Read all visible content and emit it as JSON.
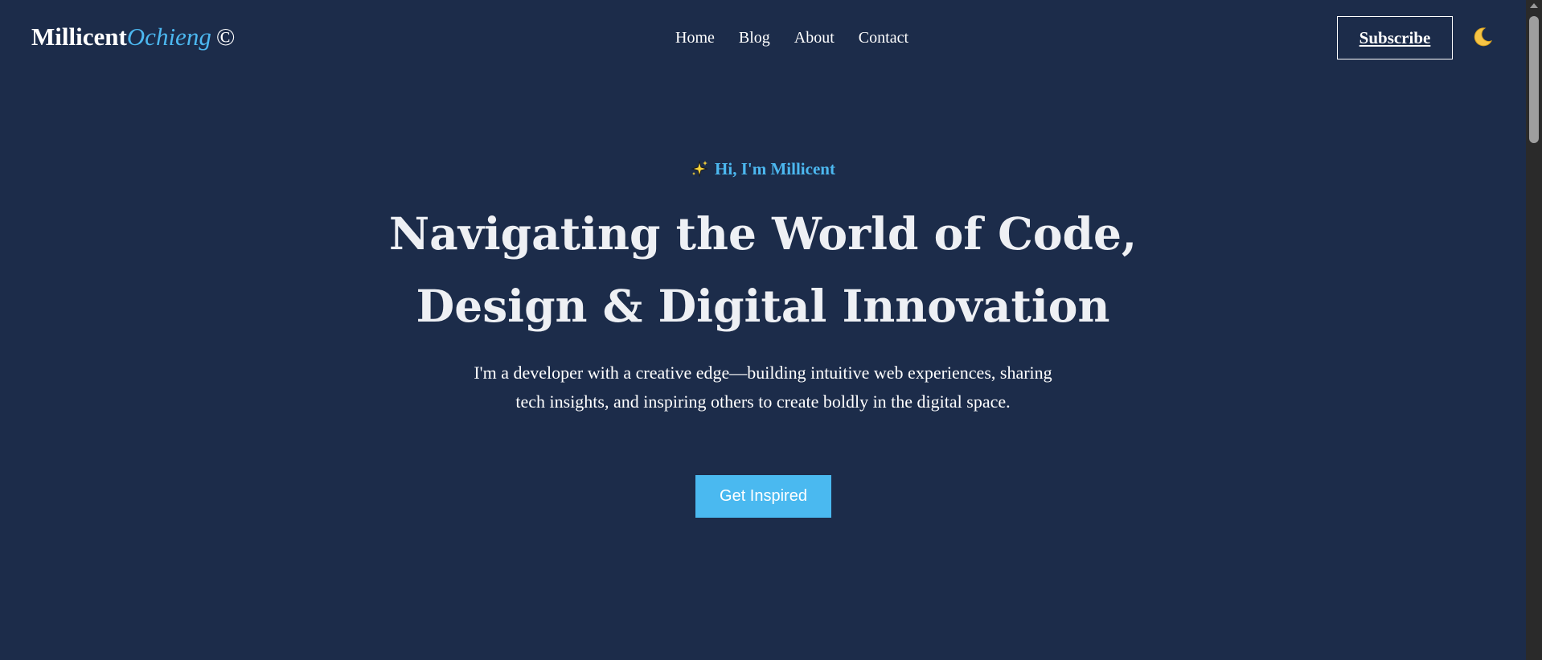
{
  "header": {
    "logo": {
      "first": "Millicent",
      "last": "Ochieng",
      "mark": "©"
    },
    "nav": [
      {
        "label": "Home"
      },
      {
        "label": "Blog"
      },
      {
        "label": "About"
      },
      {
        "label": "Contact"
      }
    ],
    "subscribe_label": "Subscribe",
    "theme_toggle_icon": "moon-icon"
  },
  "hero": {
    "eyebrow_icon": "sparkles-icon",
    "eyebrow": "Hi, I'm Millicent",
    "headline_line1": "Navigating the World of Code,",
    "headline_line2": "Design & Digital Innovation",
    "subtext": "I'm a developer with a creative edge—building intuitive web experiences, sharing tech insights, and inspiring others to create boldly in the digital space.",
    "cta_label": "Get Inspired"
  },
  "colors": {
    "background": "#1c2c4a",
    "accent": "#4cb8f0",
    "text": "#ffffff"
  }
}
